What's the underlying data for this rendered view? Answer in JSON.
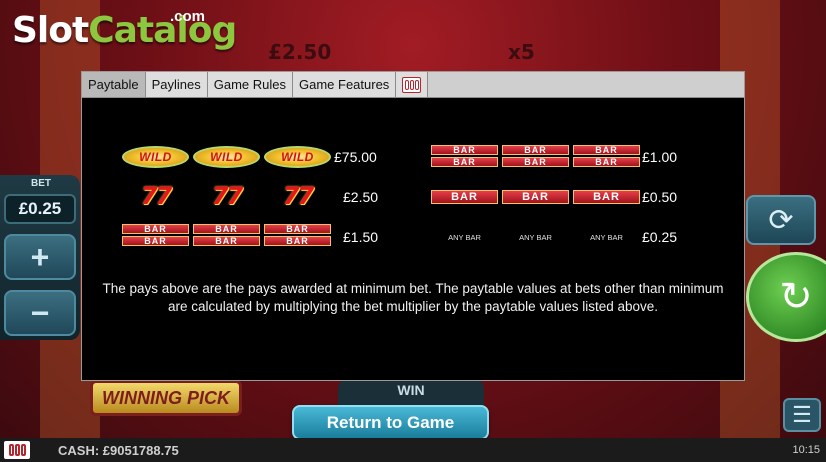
{
  "background": {
    "top_values": [
      "£2.50",
      "x5"
    ],
    "winning_pick": "WINNING PICK",
    "win_label": "WIN"
  },
  "logo": {
    "word_white": "Slot",
    "word_green": "Catalog",
    "dotcom": ".com"
  },
  "bet_panel": {
    "label": "BET",
    "value": "£0.25",
    "plus": "+",
    "minus": "−"
  },
  "tabs": [
    {
      "label": "Paytable",
      "active": true
    },
    {
      "label": "Paylines",
      "active": false
    },
    {
      "label": "Game Rules",
      "active": false
    },
    {
      "label": "Game Features",
      "active": false
    }
  ],
  "paytable": {
    "left": [
      {
        "symbol": "wild",
        "symbol_text": "WILD",
        "prize": "£75.00"
      },
      {
        "symbol": "seven",
        "symbol_text": "77",
        "prize": "£2.50"
      },
      {
        "symbol": "triple-bar",
        "symbol_text": "BAR",
        "prize": "£1.50"
      }
    ],
    "right": [
      {
        "symbol": "double-bar",
        "symbol_text": "BAR",
        "prize": "£1.00"
      },
      {
        "symbol": "single-bar",
        "symbol_text": "BAR",
        "prize": "£0.50"
      },
      {
        "symbol": "any-bar",
        "symbol_text": "ANY BAR",
        "prize": "£0.25"
      }
    ],
    "note": "The pays above are the pays awarded at minimum bet. The paytable values at bets other than minimum are calculated by multiplying the bet multiplier by the paytable values listed above."
  },
  "return_button": "Return to Game",
  "status": {
    "cash": "CASH: £9051788.75",
    "time": "10:15"
  },
  "colors": {
    "accent": "#1a7e9c",
    "logo_green": "#8dc63f",
    "bar_red": "#a3121c"
  }
}
